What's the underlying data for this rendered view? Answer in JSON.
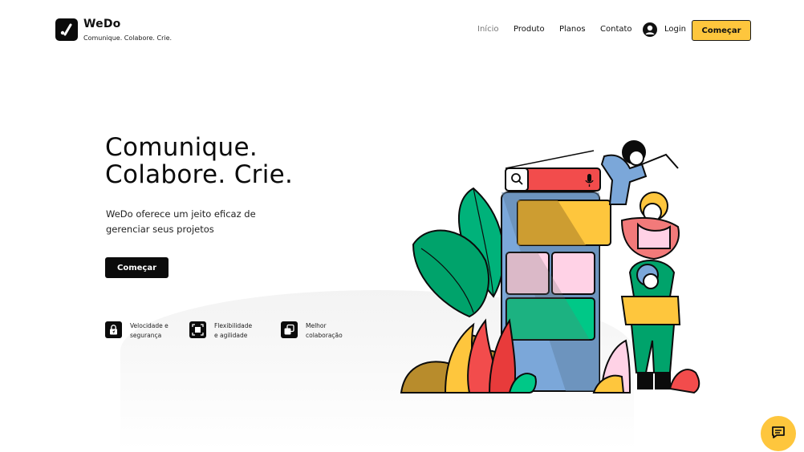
{
  "brand": {
    "name": "WeDo",
    "tagline": "Comunique. Colabore. Crie."
  },
  "nav": {
    "items": [
      {
        "label": "Início",
        "active": true
      },
      {
        "label": "Produto"
      },
      {
        "label": "Planos"
      },
      {
        "label": "Contato"
      }
    ],
    "login_label": "Login",
    "cta_label": "Começar"
  },
  "hero": {
    "title_line1": "Comunique.",
    "title_line2": "Colabore. Crie.",
    "subtitle": "WeDo oferece um jeito eficaz de gerenciar seus projetos",
    "cta_label": "Começar"
  },
  "features": [
    {
      "icon": "lock-icon",
      "line1": "Velocidade e",
      "line2": "segurança"
    },
    {
      "icon": "expand-icon",
      "line1": "Flexibilidade",
      "line2": "e agilidade"
    },
    {
      "icon": "copy-icon",
      "line1": "Melhor",
      "line2": "colaboração"
    }
  ],
  "colors": {
    "accent": "#fec63d",
    "dark": "#0b0b0b",
    "green": "#00c887",
    "pink": "#ffd2e6",
    "red": "#f25a5a",
    "blue": "#7ba7d9"
  },
  "chat": {
    "icon": "chat-icon"
  }
}
